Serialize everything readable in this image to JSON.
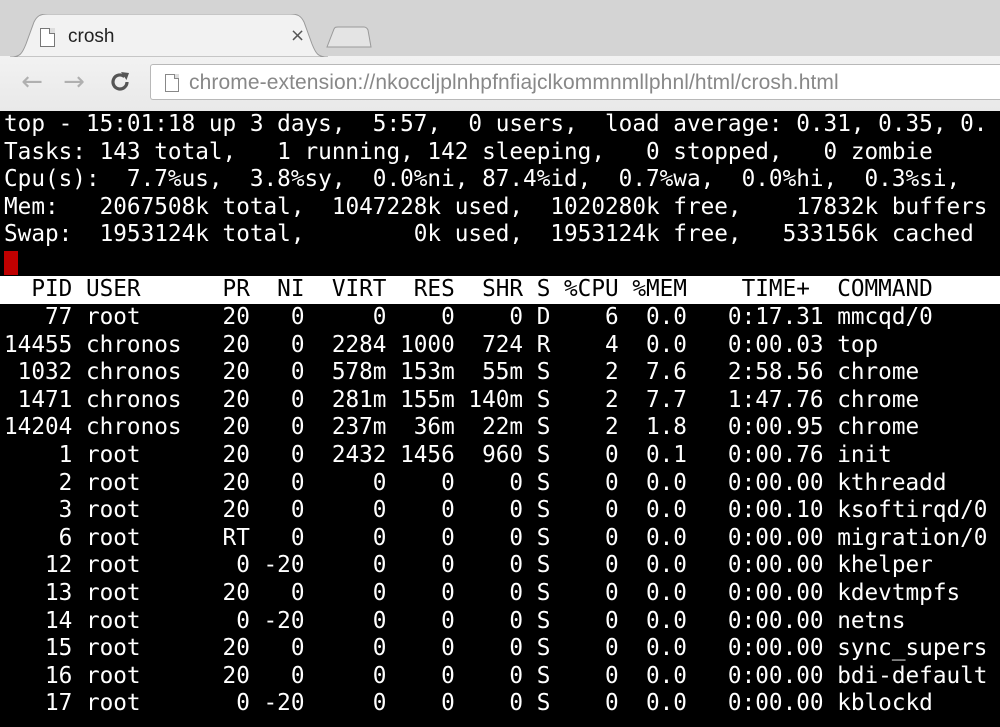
{
  "browser": {
    "tab_title": "crosh",
    "tab_close": "×",
    "url": "chrome-extension://nkoccljplnhpfnfiajclkommnmllphnl/html/crosh.html",
    "back_glyph": "←",
    "forward_glyph": "→",
    "reload_glyph": "C"
  },
  "terminal": {
    "summary_lines": [
      "top - 15:01:18 up 3 days,  5:57,  0 users,  load average: 0.31, 0.35, 0.",
      "Tasks: 143 total,   1 running, 142 sleeping,   0 stopped,   0 zombie",
      "Cpu(s):  7.7%us,  3.8%sy,  0.0%ni, 87.4%id,  0.7%wa,  0.0%hi,  0.3%si,",
      "Mem:   2067508k total,  1047228k used,  1020280k free,    17832k buffers",
      "Swap:  1953124k total,        0k used,  1953124k free,   533156k cached"
    ],
    "header": "  PID USER      PR  NI  VIRT  RES  SHR S %CPU %MEM    TIME+  COMMAND",
    "rows": [
      "   77 root      20   0     0    0    0 D    6  0.0   0:17.31 mmcqd/0",
      "14455 chronos   20   0  2284 1000  724 R    4  0.0   0:00.03 top",
      " 1032 chronos   20   0  578m 153m  55m S    2  7.6   2:58.56 chrome",
      " 1471 chronos   20   0  281m 155m 140m S    2  7.7   1:47.76 chrome",
      "14204 chronos   20   0  237m  36m  22m S    2  1.8   0:00.95 chrome",
      "    1 root      20   0  2432 1456  960 S    0  0.1   0:00.76 init",
      "    2 root      20   0     0    0    0 S    0  0.0   0:00.00 kthreadd",
      "    3 root      20   0     0    0    0 S    0  0.0   0:00.10 ksoftirqd/0",
      "    6 root      RT   0     0    0    0 S    0  0.0   0:00.00 migration/0",
      "   12 root       0 -20     0    0    0 S    0  0.0   0:00.00 khelper",
      "   13 root      20   0     0    0    0 S    0  0.0   0:00.00 kdevtmpfs",
      "   14 root       0 -20     0    0    0 S    0  0.0   0:00.00 netns",
      "   15 root      20   0     0    0    0 S    0  0.0   0:00.00 sync_supers",
      "   16 root      20   0     0    0    0 S    0  0.0   0:00.00 bdi-default",
      "   17 root       0 -20     0    0    0 S    0  0.0   0:00.00 kblockd"
    ]
  }
}
